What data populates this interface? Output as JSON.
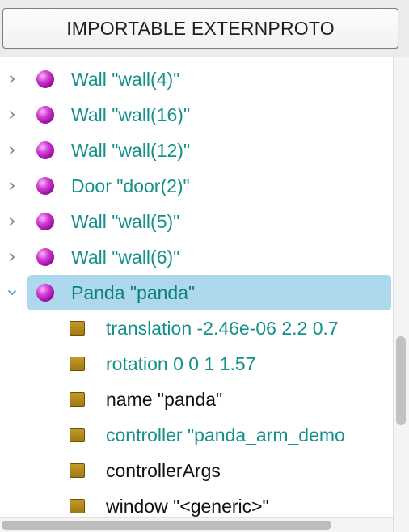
{
  "toolbar": {
    "import_button_label": "IMPORTABLE EXTERNPROTO"
  },
  "tree": {
    "nodes": [
      {
        "label": "Wall \"wall(4)\"",
        "icon": "solid-node-sphere-icon",
        "expanded": false
      },
      {
        "label": "Wall \"wall(16)\"",
        "icon": "solid-node-sphere-icon",
        "expanded": false
      },
      {
        "label": "Wall \"wall(12)\"",
        "icon": "solid-node-sphere-icon",
        "expanded": false
      },
      {
        "label": "Door \"door(2)\"",
        "icon": "solid-node-sphere-icon",
        "expanded": false
      },
      {
        "label": "Wall \"wall(5)\"",
        "icon": "solid-node-sphere-icon",
        "expanded": false
      },
      {
        "label": "Wall \"wall(6)\"",
        "icon": "solid-node-sphere-icon",
        "expanded": false
      },
      {
        "label": "Panda \"panda\"",
        "icon": "solid-node-sphere-icon",
        "expanded": true,
        "selected": true
      }
    ],
    "fields": [
      {
        "label": "translation -2.46e-06 2.2 0.7",
        "modified": true
      },
      {
        "label": "rotation 0 0 1 1.57",
        "modified": true
      },
      {
        "label": "name \"panda\"",
        "modified": false
      },
      {
        "label": "controller \"panda_arm_demo",
        "modified": true
      },
      {
        "label": "controllerArgs",
        "modified": false
      },
      {
        "label": "window \"<generic>\"",
        "modified": false
      }
    ]
  },
  "colors": {
    "modified_text": "#13908a",
    "default_text": "#111111",
    "selection": "#aed8ee",
    "node_sphere": "#c32bc8",
    "field_box": "#b08a1c"
  }
}
